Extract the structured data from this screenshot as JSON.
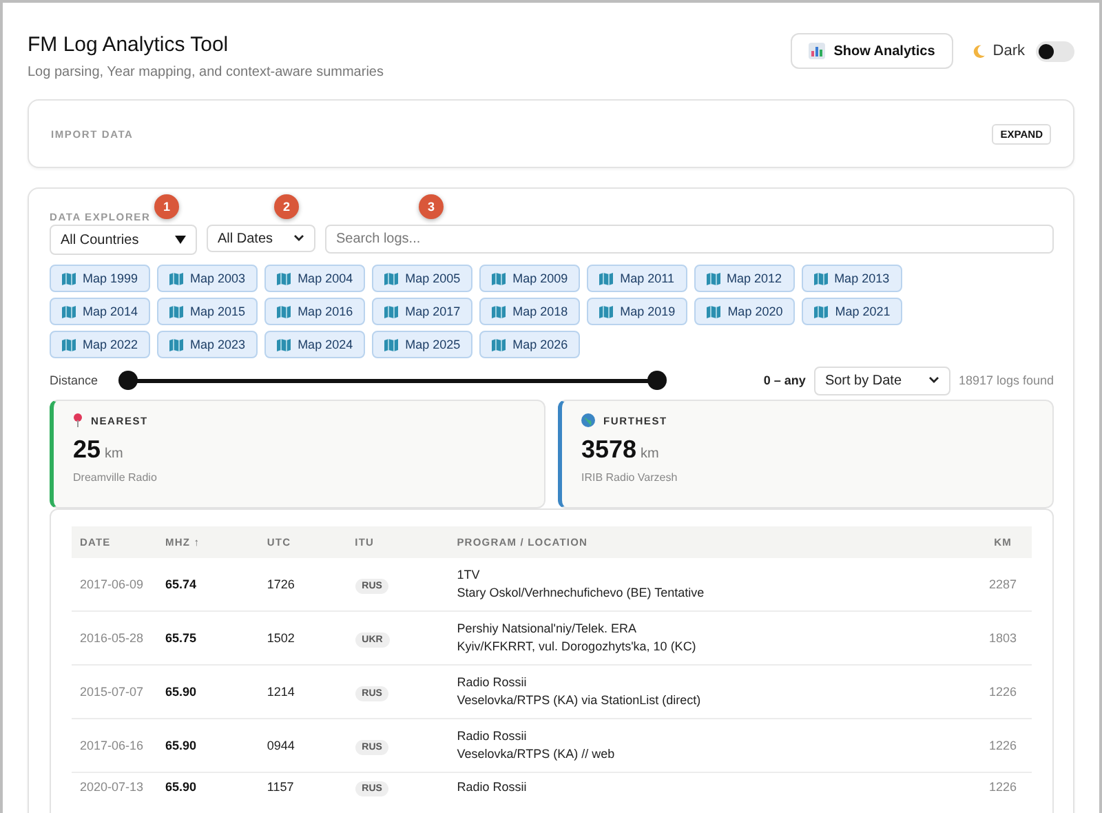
{
  "header": {
    "title": "FM Log Analytics Tool",
    "subtitle": "Log parsing, Year mapping, and context-aware summaries",
    "analytics_button": "Show Analytics",
    "dark_toggle": {
      "label": "Dark",
      "on": false
    }
  },
  "import_panel": {
    "title": "IMPORT DATA",
    "button": "EXPAND"
  },
  "explorer": {
    "title": "DATA EXPLORER",
    "country_select": "All Countries",
    "date_select": "All Dates",
    "search": {
      "placeholder": "Search logs..."
    },
    "step_badges": [
      "1",
      "2",
      "3"
    ],
    "maps": [
      "Map 1999",
      "Map 2003",
      "Map 2004",
      "Map 2005",
      "Map 2009",
      "Map 2011",
      "Map 2012",
      "Map 2013",
      "Map 2014",
      "Map 2015",
      "Map 2016",
      "Map 2017",
      "Map 2018",
      "Map 2019",
      "Map 2020",
      "Map 2021",
      "Map 2022",
      "Map 2023",
      "Map 2024",
      "Map 2025",
      "Map 2026"
    ],
    "distance": {
      "label": "Distance",
      "thumbs": [
        {
          "level": 0
        },
        {
          "level": 1
        }
      ],
      "reading": "0 – any"
    },
    "sort_select": "Sort by Date",
    "count": "18917 logs found",
    "stats": [
      {
        "kind": "nearest",
        "label": "NEAREST",
        "value": "25",
        "unit": "km",
        "station": "Dreamville Radio",
        "color": "#2fae5c"
      },
      {
        "kind": "furthest",
        "label": "FURTHEST",
        "value": "3578",
        "unit": "km",
        "station": "IRIB Radio Varzesh",
        "color": "#3b86c4"
      }
    ],
    "table": {
      "columns": [
        "DATE",
        "MHZ ↑",
        "UTC",
        "ITU",
        "PROGRAM / LOCATION",
        "KM"
      ],
      "rows": [
        {
          "date": "2017-06-09",
          "mhz": "65.74",
          "utc": "1726",
          "itu": "RUS",
          "program": "1TV",
          "location": "Stary Oskol/Verhnechufichevo (BE) Tentative",
          "km": "2287"
        },
        {
          "date": "2016-05-28",
          "mhz": "65.75",
          "utc": "1502",
          "itu": "UKR",
          "program": "Pershiy Natsional'niy/Telek. ERA",
          "location": "Kyiv/KFKRRT, vul. Dorogozhyts'ka, 10 (KC)",
          "km": "1803"
        },
        {
          "date": "2015-07-07",
          "mhz": "65.90",
          "utc": "1214",
          "itu": "RUS",
          "program": "Radio Rossii",
          "location": "Veselovka/RTPS (KA) via StationList (direct)",
          "km": "1226"
        },
        {
          "date": "2017-06-16",
          "mhz": "65.90",
          "utc": "0944",
          "itu": "RUS",
          "program": "Radio Rossii",
          "location": "Veselovka/RTPS (KA) // web",
          "km": "1226"
        },
        {
          "date": "2020-07-13",
          "mhz": "65.90",
          "utc": "1157",
          "itu": "RUS",
          "program": "Radio Rossii",
          "km": "1226"
        }
      ]
    }
  }
}
